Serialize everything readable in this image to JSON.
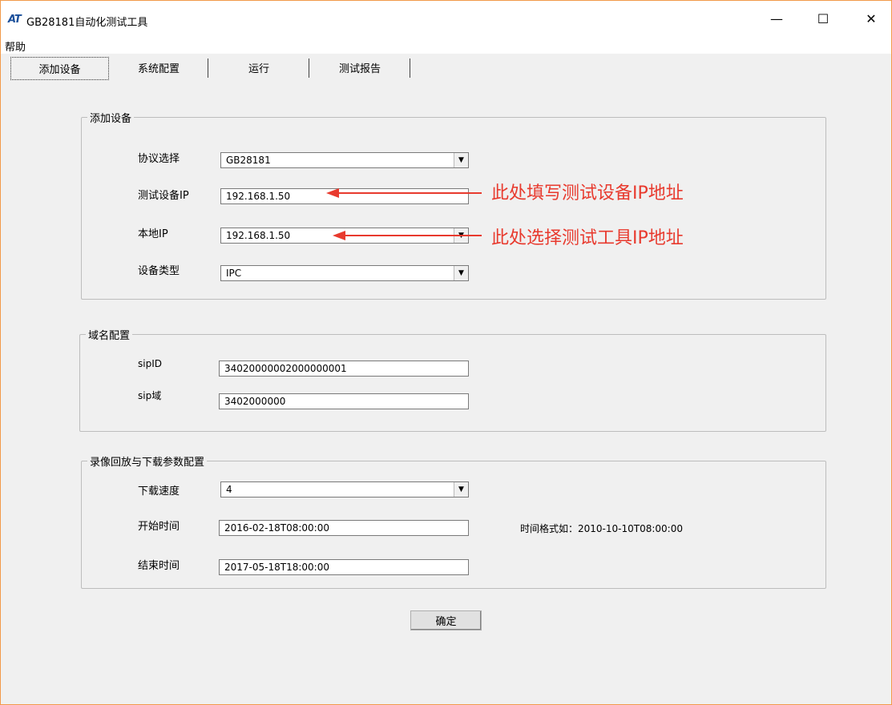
{
  "window": {
    "logo": "AT",
    "title": "GB28181自动化测试工具",
    "minimize_glyph": "—",
    "maximize_glyph": "☐",
    "close_glyph": "✕"
  },
  "menu": {
    "help": "帮助"
  },
  "tabs": [
    "添加设备",
    "系统配置",
    "运行",
    "测试报告"
  ],
  "add_device": {
    "group_title": "添加设备",
    "protocol": {
      "label": "协议选择",
      "value": "GB28181"
    },
    "device_ip": {
      "label": "测试设备IP",
      "value": "192.168.1.50"
    },
    "local_ip": {
      "label": "本地IP",
      "value": "192.168.1.50"
    },
    "device_type": {
      "label": "设备类型",
      "value": "IPC"
    }
  },
  "domain": {
    "group_title": "域名配置",
    "sip_id": {
      "label": "sipID",
      "value": "34020000002000000001"
    },
    "sip_domain": {
      "label": "sip域",
      "value": "3402000000"
    }
  },
  "playback": {
    "group_title": "录像回放与下载参数配置",
    "speed": {
      "label": "下载速度",
      "value": "4"
    },
    "start": {
      "label": "开始时间",
      "value": "2016-02-18T08:00:00"
    },
    "end": {
      "label": "结束时间",
      "value": "2017-05-18T18:00:00"
    },
    "time_hint": "时间格式如：2010-10-10T08:00:00"
  },
  "ok_button": "确定",
  "annotations": {
    "device_ip_note": "此处填写测试设备IP地址",
    "local_ip_note": "此处选择测试工具IP地址",
    "color": "#e83a2e"
  },
  "colors": {
    "window_border": "#f29a4a",
    "background": "#f0f0f0"
  },
  "icons": {
    "dropdown": "chevron-down-icon"
  }
}
